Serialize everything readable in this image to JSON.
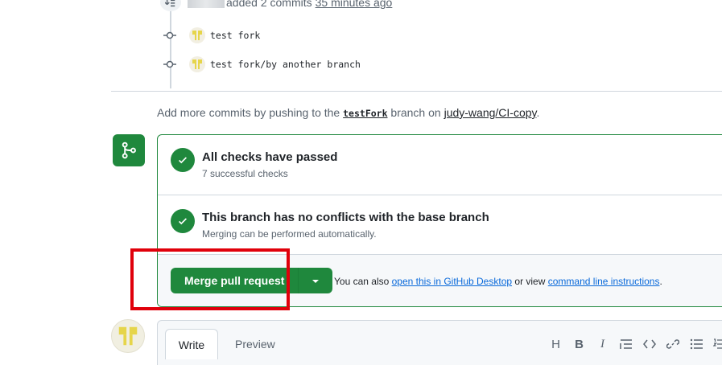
{
  "timeline": {
    "event_text": "added 2 commits",
    "event_time": "35 minutes ago",
    "commits": [
      {
        "message": "test fork"
      },
      {
        "message": "test fork/by another branch"
      }
    ]
  },
  "hint": {
    "prefix": "Add more commits by pushing to the",
    "branch": "testFork",
    "middle": "branch on",
    "repo": "judy-wang/CI-copy",
    "suffix": "."
  },
  "checks": [
    {
      "title": "All checks have passed",
      "subtitle": "7 successful checks"
    },
    {
      "title": "This branch has no conflicts with the base branch",
      "subtitle": "Merging can be performed automatically."
    }
  ],
  "merge": {
    "button_label": "Merge pull request",
    "also_prefix": "You can also",
    "desktop_link": "open this in GitHub Desktop",
    "also_middle": "or view",
    "cli_link": "command line instructions",
    "also_suffix": "."
  },
  "comment": {
    "tab_write": "Write",
    "tab_preview": "Preview",
    "toolbar": [
      "H",
      "B",
      "I",
      "quote",
      "code",
      "link",
      "bulleted-list",
      "numbered-list"
    ]
  },
  "colors": {
    "success_green": "#1f883d",
    "link_blue": "#0969da",
    "highlight_red": "#e0000b"
  }
}
